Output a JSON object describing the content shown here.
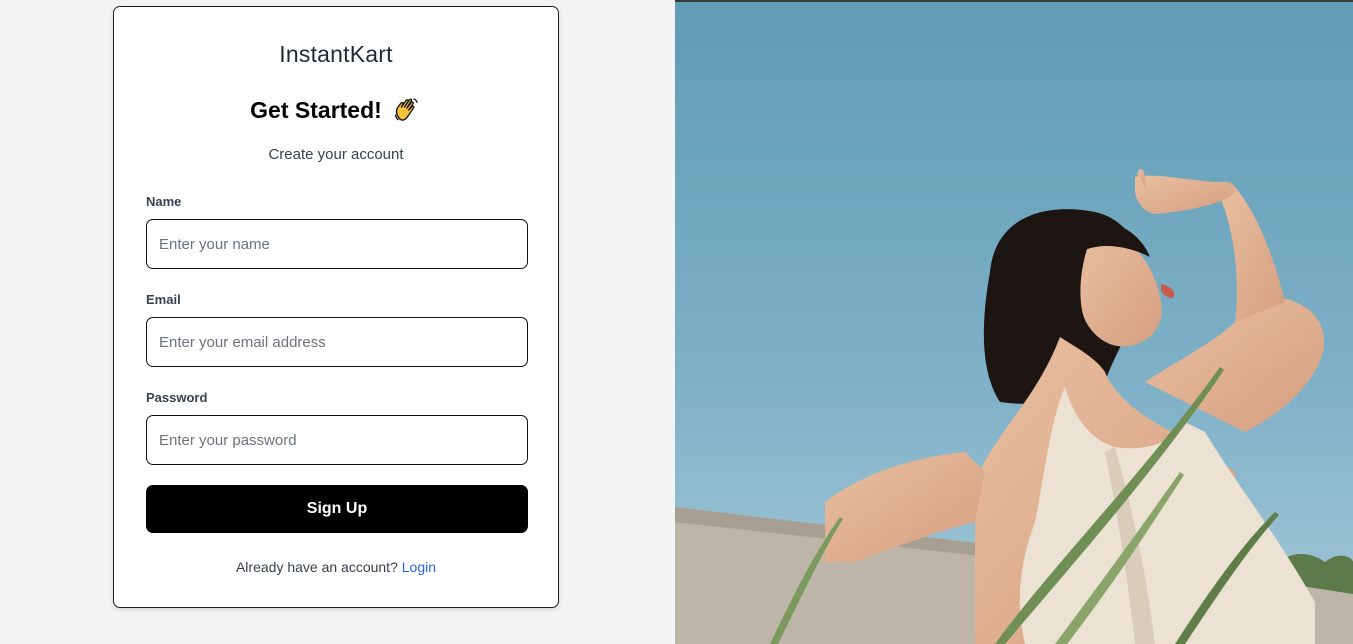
{
  "brand": {
    "name": "InstantKart"
  },
  "signup": {
    "headline": "Get Started!",
    "subtitle": "Create your account",
    "fields": [
      {
        "label": "Name",
        "placeholder": "Enter your name",
        "value": ""
      },
      {
        "label": "Email",
        "placeholder": "Enter your email address",
        "value": ""
      },
      {
        "label": "Password",
        "placeholder": "Enter your password",
        "value": ""
      }
    ],
    "submit_label": "Sign Up",
    "footer_text": "Already have an account?",
    "login_link": "Login"
  },
  "icons": {
    "headline_emoji": "waving-hand-icon"
  },
  "colors": {
    "page_background": "#f3f4f6",
    "button_background": "#000000",
    "link": "#2563eb",
    "sky": "#6ea3bc"
  }
}
